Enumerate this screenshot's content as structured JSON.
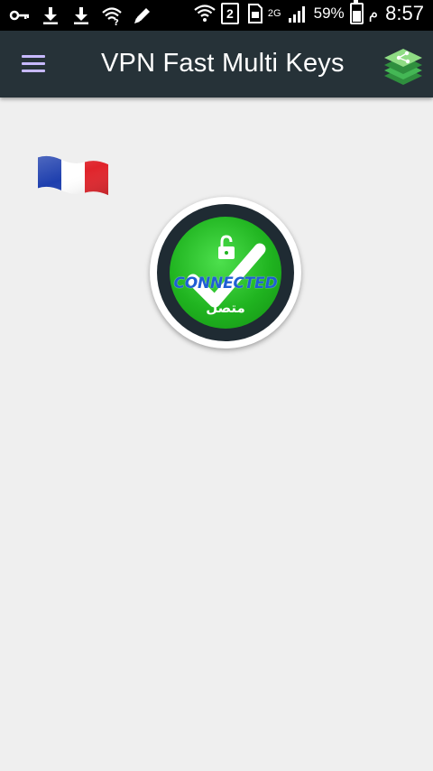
{
  "status_bar": {
    "battery_percent": "59%",
    "time": "8:57",
    "network": "2G",
    "sim_slot": "2",
    "carrier_glyph": "م",
    "battery_level": 0.59,
    "icons": [
      "key-icon",
      "download-icon",
      "download-icon",
      "wifi-question-icon",
      "pencil-icon",
      "wifi-icon",
      "sim-icon",
      "sim-card-icon",
      "signal-icon",
      "battery-icon"
    ]
  },
  "app_bar": {
    "title": "VPN Fast Multi Keys",
    "menu_icon": "hamburger-menu-icon",
    "share_icon": "share-stack-icon"
  },
  "main": {
    "country_flag": "france-flag-icon",
    "connect_button": {
      "status_en": "CONNECTED",
      "status_ar": "متصل",
      "colors": {
        "ring": "#1f2b33",
        "fill": "#22b422",
        "text": "#1f5fd4"
      }
    }
  },
  "colors": {
    "app_bar": "#263238",
    "background": "#efefef",
    "menu_icon": "#c7b9ff"
  }
}
